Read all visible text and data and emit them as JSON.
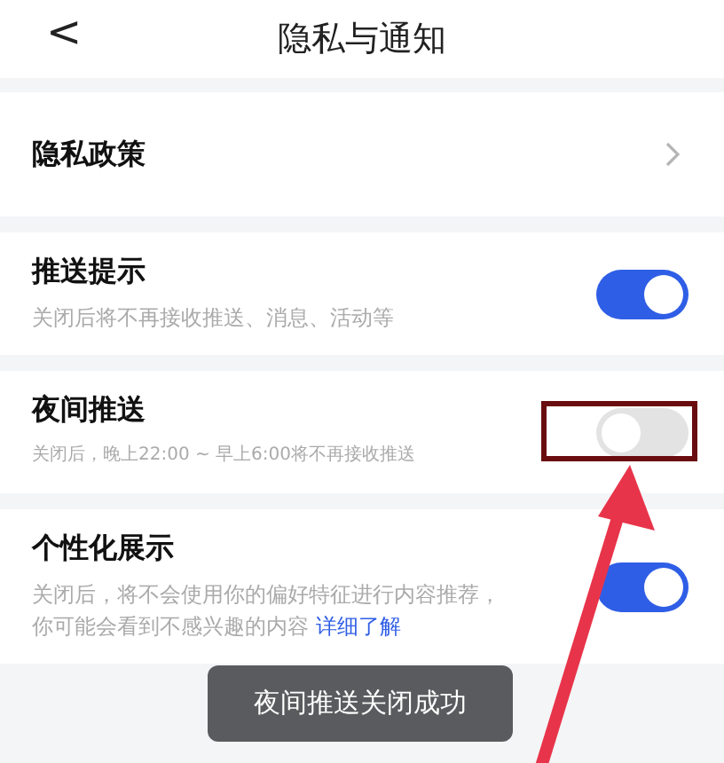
{
  "header": {
    "back_icon": "<",
    "title": "隐私与通知"
  },
  "items": [
    {
      "kind": "link",
      "title": "隐私政策"
    },
    {
      "kind": "toggle",
      "title": "推送提示",
      "description": "关闭后将不再接收推送、消息、活动等",
      "on": true
    },
    {
      "kind": "toggle",
      "title": "夜间推送",
      "description": "关闭后，晚上22:00 ~ 早上6:00将不再接收推送",
      "on": false,
      "small": true,
      "highlighted": true
    },
    {
      "kind": "toggle",
      "title": "个性化展示",
      "description": "关闭后，将不会使用你的偏好特征进行内容推荐，你可能会看到不感兴趣的内容",
      "link": "详细了解",
      "on": true
    }
  ],
  "toast": "夜间推送关闭成功"
}
